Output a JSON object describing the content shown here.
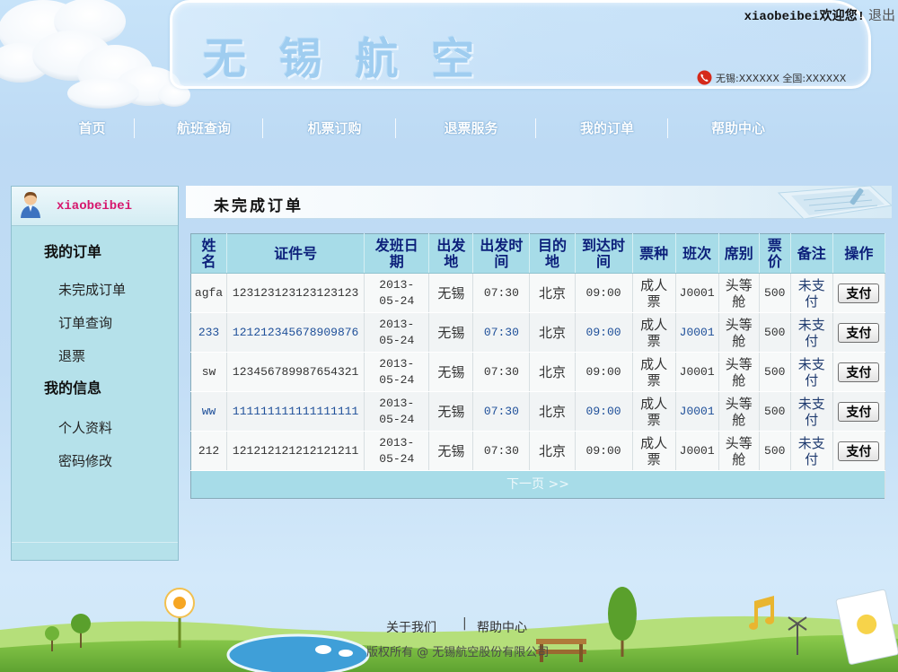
{
  "header": {
    "logo_text": "无 锡 航 空",
    "welcome_text": "xiaobeibei欢迎您!",
    "logout_label": "退出",
    "hotline_text": "无锡:XXXXXX 全国:XXXXXX"
  },
  "nav": [
    "首页",
    "航班查询",
    "机票订购",
    "退票服务",
    "我的订单",
    "帮助中心"
  ],
  "sidebar": {
    "username": "xiaobeibei",
    "sections": [
      {
        "title": "我的订单",
        "items": [
          "未完成订单",
          "订单查询",
          "退票"
        ]
      },
      {
        "title": "我的信息",
        "items": [
          "个人资料",
          "密码修改"
        ]
      }
    ]
  },
  "main": {
    "title": "未完成订单",
    "table": {
      "columns": [
        "姓名",
        "证件号",
        "发班日期",
        "出发地",
        "出发时间",
        "目的地",
        "到达时间",
        "票种",
        "班次",
        "席别",
        "票价",
        "备注",
        "操作"
      ],
      "rows": [
        {
          "name": "agfa",
          "id_number": "123123123123123123",
          "date": "2013-05-24",
          "origin": "无锡",
          "depart_time": "07:30",
          "destination": "北京",
          "arrive_time": "09:00",
          "ticket_type": "成人票",
          "flight": "J0001",
          "seat_class": "头等舱",
          "price": "500",
          "remark": "未支付"
        },
        {
          "name": "233",
          "id_number": "121212345678909876",
          "date": "2013-05-24",
          "origin": "无锡",
          "depart_time": "07:30",
          "destination": "北京",
          "arrive_time": "09:00",
          "ticket_type": "成人票",
          "flight": "J0001",
          "seat_class": "头等舱",
          "price": "500",
          "remark": "未支付"
        },
        {
          "name": "sw",
          "id_number": "123456789987654321",
          "date": "2013-05-24",
          "origin": "无锡",
          "depart_time": "07:30",
          "destination": "北京",
          "arrive_time": "09:00",
          "ticket_type": "成人票",
          "flight": "J0001",
          "seat_class": "头等舱",
          "price": "500",
          "remark": "未支付"
        },
        {
          "name": "ww",
          "id_number": "111111111111111111",
          "date": "2013-05-24",
          "origin": "无锡",
          "depart_time": "07:30",
          "destination": "北京",
          "arrive_time": "09:00",
          "ticket_type": "成人票",
          "flight": "J0001",
          "seat_class": "头等舱",
          "price": "500",
          "remark": "未支付"
        },
        {
          "name": "212",
          "id_number": "121212121212121211",
          "date": "2013-05-24",
          "origin": "无锡",
          "depart_time": "07:30",
          "destination": "北京",
          "arrive_time": "09:00",
          "ticket_type": "成人票",
          "flight": "J0001",
          "seat_class": "头等舱",
          "price": "500",
          "remark": "未支付"
        }
      ],
      "action_label": "支付",
      "next_page_label": "下一页 >>"
    }
  },
  "footer": {
    "links": [
      "关于我们",
      "帮助中心"
    ],
    "separator": "|",
    "copyright": "版权所有 @ 无锡航空股份有限公司"
  },
  "icons": {
    "user_avatar": "user-avatar-icon",
    "hotline": "phone-icon"
  },
  "colors": {
    "table_header_bg": "#a7dce8",
    "table_header_text": "#0c1f7a",
    "username": "#d6176d",
    "sidebar_bg": "#b5e1ea",
    "link_blue": "#1e4f99",
    "nav_text": "#ffffff"
  }
}
